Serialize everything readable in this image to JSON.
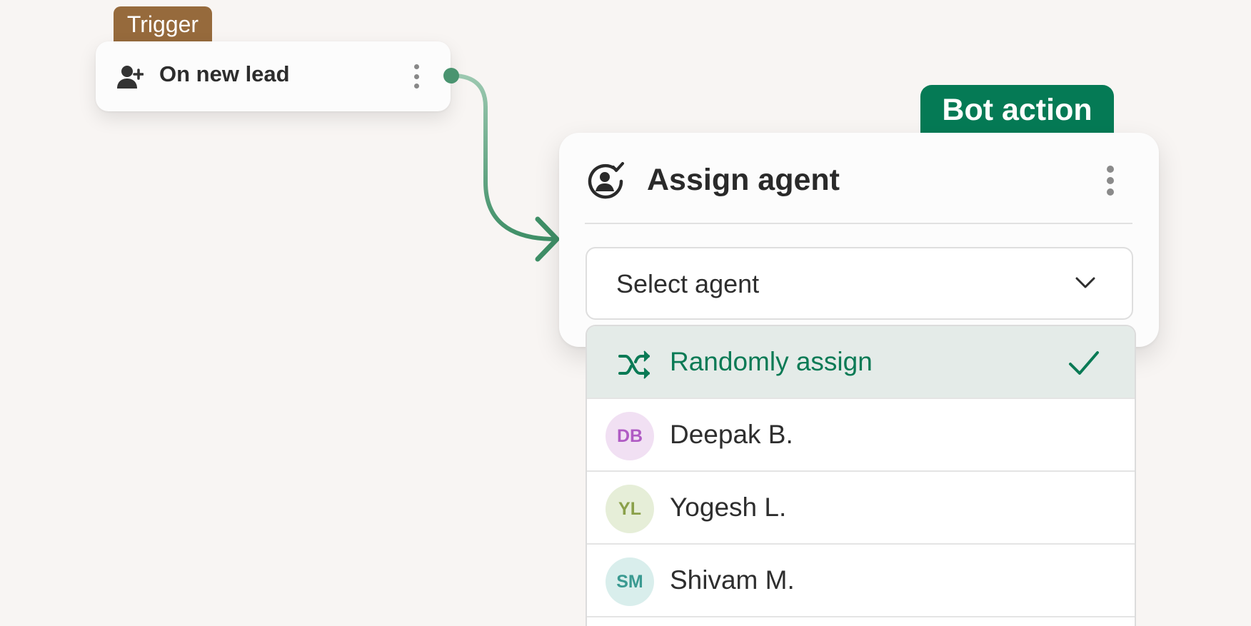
{
  "trigger": {
    "tag": "Trigger",
    "title": "On new lead",
    "icon": "user-plus-icon"
  },
  "bot_action": {
    "tag": "Bot action",
    "title": "Assign agent",
    "icon": "user-check-circle-icon",
    "select": {
      "placeholder": "Select agent",
      "icon": "chevron-down-icon"
    },
    "options": [
      {
        "label": "Randomly assign",
        "icon": "shuffle-icon",
        "selected": true
      },
      {
        "label": "Deepak B.",
        "initials": "DB",
        "avatar_bg": "#f1e0f3",
        "avatar_fg": "#b05bc4"
      },
      {
        "label": "Yogesh L.",
        "initials": "YL",
        "avatar_bg": "#e6eed8",
        "avatar_fg": "#8aa04a"
      },
      {
        "label": "Shivam M.",
        "initials": "SM",
        "avatar_bg": "#d9eeec",
        "avatar_fg": "#3a9a91"
      }
    ]
  },
  "colors": {
    "background": "#f8f5f3",
    "trigger_tag": "#966a3c",
    "bot_tag": "#057a55",
    "accent": "#0a7a55",
    "connector": "#4f9a75"
  }
}
